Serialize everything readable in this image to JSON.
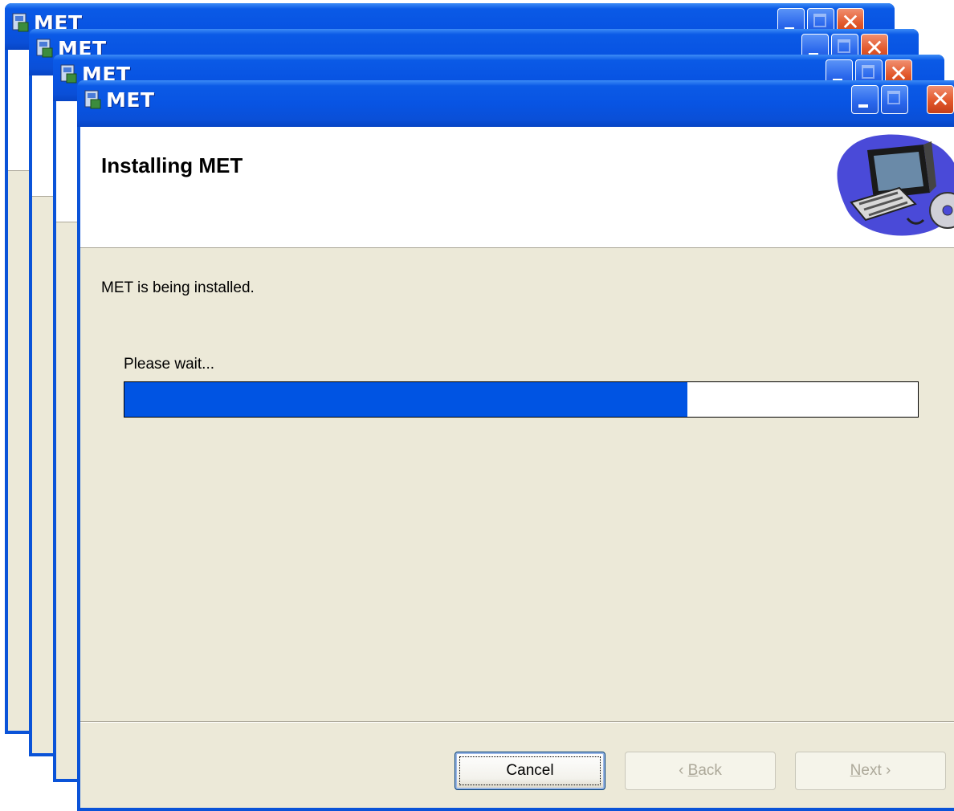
{
  "windows": [
    {
      "title": "MET"
    },
    {
      "title": "MET"
    },
    {
      "title": "MET"
    }
  ],
  "dialog": {
    "title": "MET",
    "heading": "Installing MET",
    "status_message": "MET is being installed.",
    "progress_label": "Please wait...",
    "progress_fraction": 0.71,
    "title_buttons": [
      "minimize-icon",
      "maximize-icon",
      "close-icon"
    ],
    "buttons": {
      "cancel_label": "Cancel",
      "back_label": "< Back",
      "back_label_prefix": "‹ ",
      "back_accel": "B",
      "back_label_rest": "ack",
      "next_label": "Next >",
      "next_accel": "N",
      "next_label_rest": "ext ›"
    }
  },
  "colors": {
    "titlebar": "#0854e3",
    "client_background": "#ece9d8",
    "progress_fill": "#0054e3",
    "close_button": "#e2572a"
  }
}
